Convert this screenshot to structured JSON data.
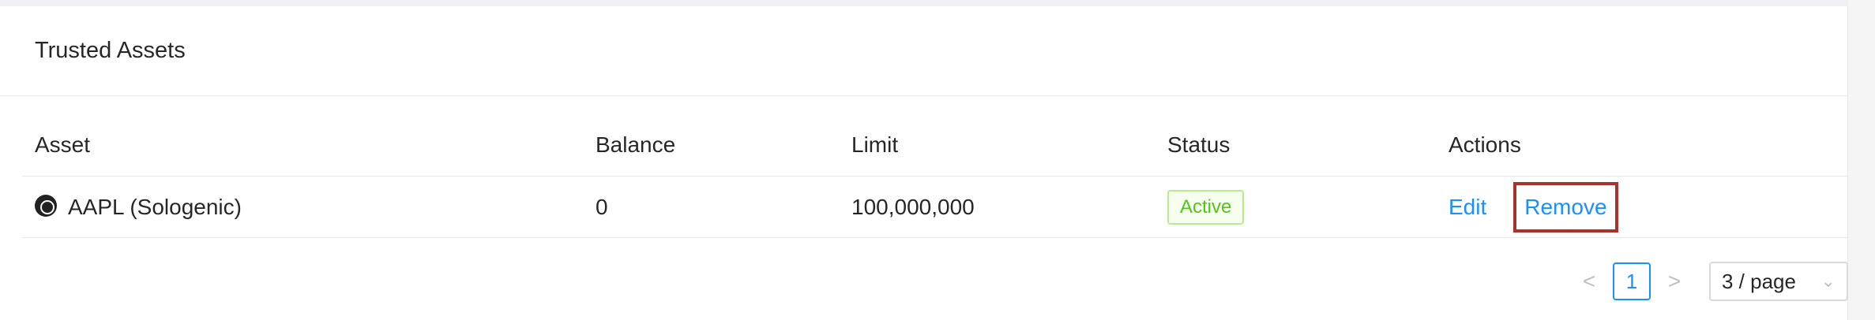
{
  "card": {
    "title": "Trusted Assets"
  },
  "table": {
    "columns": [
      "Asset",
      "Balance",
      "Limit",
      "Status",
      "Actions"
    ],
    "rows": [
      {
        "asset": "AAPL (Sologenic)",
        "asset_icon": "sologenic-coin-icon",
        "balance": "0",
        "limit": "100,000,000",
        "status": "Active",
        "actions": {
          "edit": "Edit",
          "remove": "Remove"
        }
      }
    ]
  },
  "pagination": {
    "prev": "<",
    "current_page": "1",
    "next": ">",
    "page_size": "3 / page"
  },
  "colors": {
    "link": "#1890ff",
    "status_active": "#52c41a",
    "highlight_box": "#a8322d"
  }
}
